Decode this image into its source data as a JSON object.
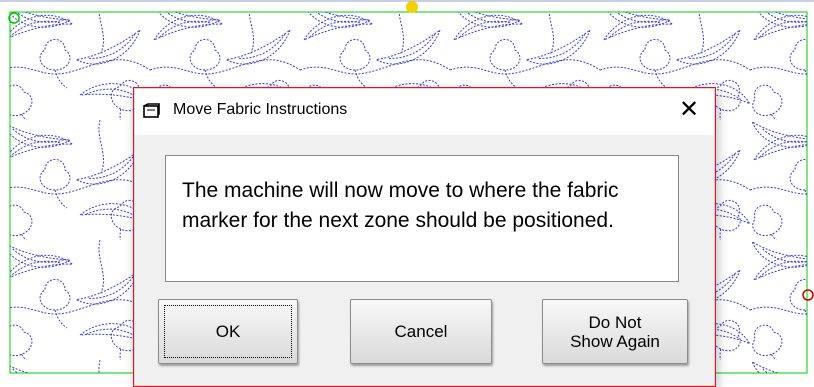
{
  "dialog": {
    "title": "Move Fabric Instructions",
    "close_glyph": "✕",
    "message": "The machine will now move to where the fabric marker for the next zone should be positioned.",
    "buttons": {
      "ok": "OK",
      "cancel": "Cancel",
      "do_not_show": "Do Not\nShow Again"
    }
  },
  "colors": {
    "pattern_line": "#3b3bd6",
    "boundary": "#00cc00",
    "dialog_border": "#e81123",
    "start_marker": "#00cc00",
    "end_marker": "#cc0000",
    "needle_marker": "#f5d000"
  }
}
